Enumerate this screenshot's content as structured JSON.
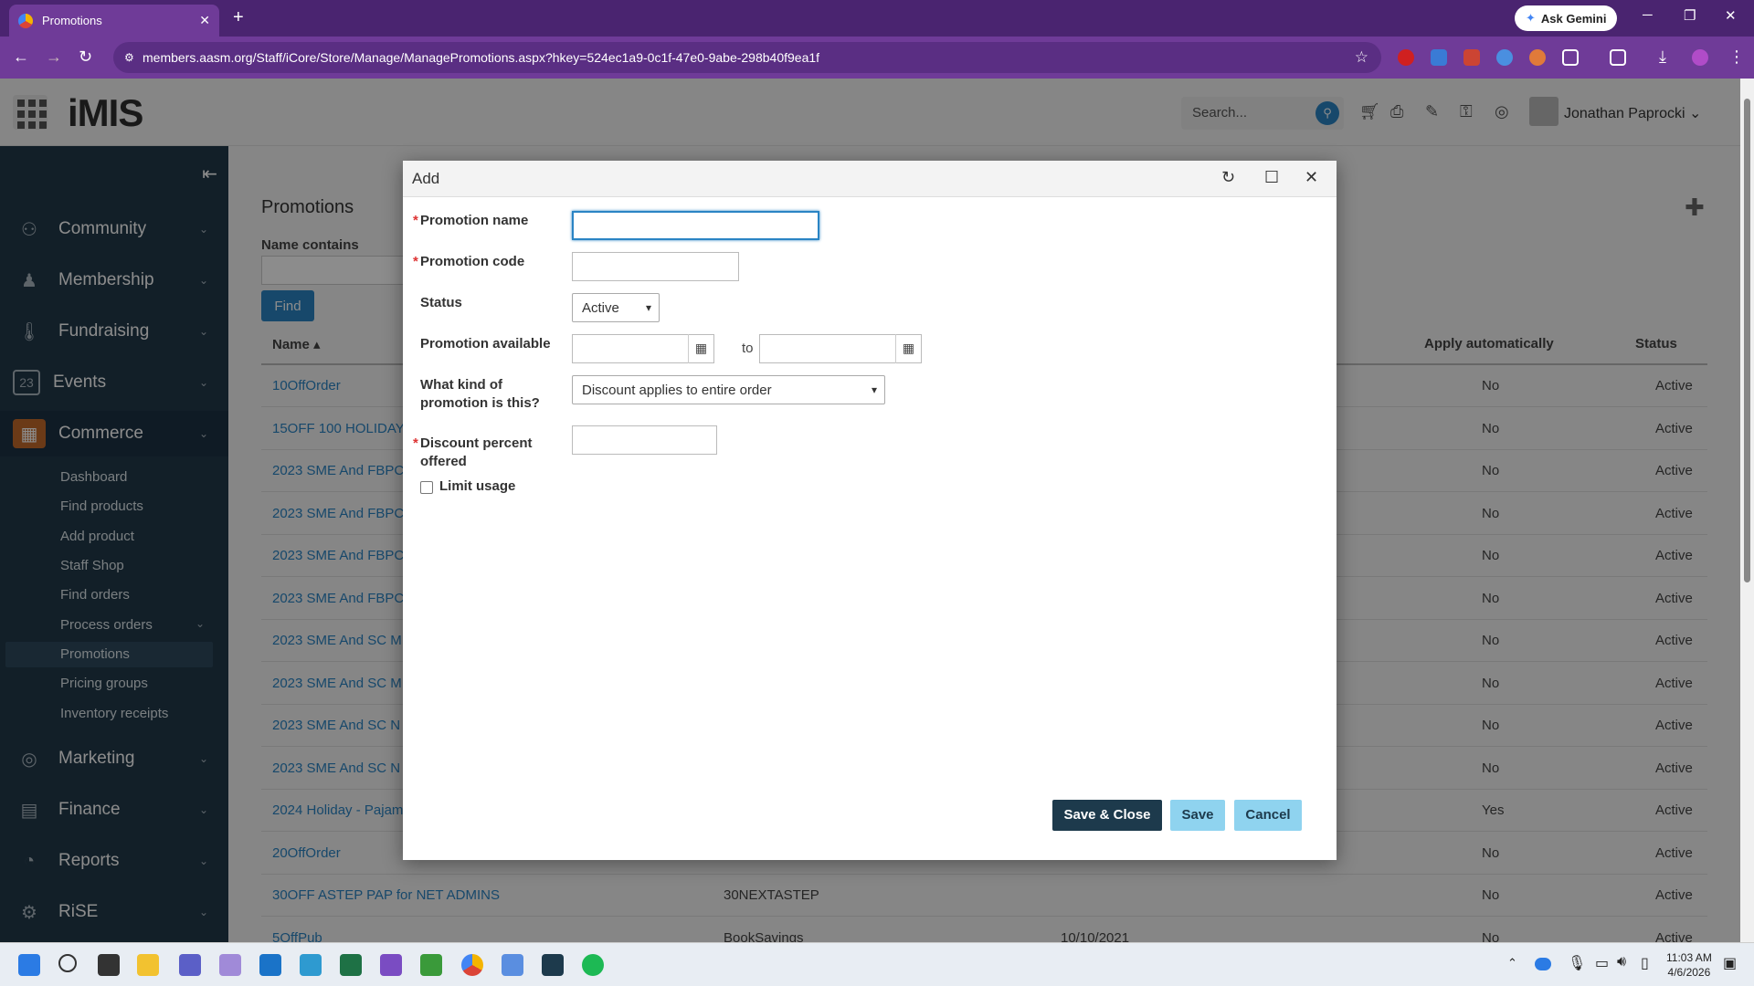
{
  "browser": {
    "tab_title": "Promotions",
    "url": "members.aasm.org/Staff/iCore/Store/Manage/ManagePromotions.aspx?hkey=524ec1a9-0c1f-47e0-9abe-298b40f9ea1f",
    "gemini_label": "Ask Gemini"
  },
  "header": {
    "logo": "iMIS",
    "search_placeholder": "Search...",
    "user_name": "Jonathan Paprocki"
  },
  "sidebar": {
    "items": [
      {
        "label": "Community"
      },
      {
        "label": "Membership"
      },
      {
        "label": "Fundraising"
      },
      {
        "label": "Events"
      },
      {
        "label": "Commerce"
      },
      {
        "label": "Marketing"
      },
      {
        "label": "Finance"
      },
      {
        "label": "Reports"
      },
      {
        "label": "RiSE"
      }
    ],
    "commerce_sub": [
      "Dashboard",
      "Find products",
      "Add product",
      "Staff Shop",
      "Find orders",
      "Process orders",
      "Promotions",
      "Pricing groups",
      "Inventory receipts"
    ]
  },
  "page": {
    "title": "Promotions",
    "name_contains_label": "Name contains",
    "find_label": "Find",
    "columns": {
      "name": "Name ▴",
      "apply": "Apply automatically",
      "status": "Status"
    },
    "rows": [
      {
        "name": "10OffOrder",
        "code": "",
        "date": "",
        "apply": "No",
        "status": "Active"
      },
      {
        "name": "15OFF 100 HOLIDAY",
        "code": "",
        "date": "",
        "apply": "No",
        "status": "Active"
      },
      {
        "name": "2023 SME And FBPC",
        "code": "",
        "date": "",
        "apply": "No",
        "status": "Active"
      },
      {
        "name": "2023 SME And FBPC",
        "code": "",
        "date": "",
        "apply": "No",
        "status": "Active"
      },
      {
        "name": "2023 SME And FBPC",
        "code": "",
        "date": "",
        "apply": "No",
        "status": "Active"
      },
      {
        "name": "2023 SME And FBPC",
        "code": "",
        "date": "",
        "apply": "No",
        "status": "Active"
      },
      {
        "name": "2023 SME And SC M",
        "code": "",
        "date": "",
        "apply": "No",
        "status": "Active"
      },
      {
        "name": "2023 SME And SC M",
        "code": "",
        "date": "",
        "apply": "No",
        "status": "Active"
      },
      {
        "name": "2023 SME And SC N",
        "code": "",
        "date": "",
        "apply": "No",
        "status": "Active"
      },
      {
        "name": "2023 SME And SC N",
        "code": "",
        "date": "",
        "apply": "No",
        "status": "Active"
      },
      {
        "name": "2024 Holiday - Pajam",
        "code": "",
        "date": "",
        "apply": "Yes",
        "status": "Active"
      },
      {
        "name": "20OffOrder",
        "code": "",
        "date": "",
        "apply": "No",
        "status": "Active"
      },
      {
        "name": "30OFF ASTEP PAP for NET ADMINS",
        "code": "30NEXTASTEP",
        "date": "",
        "apply": "No",
        "status": "Active"
      },
      {
        "name": "5OffPub",
        "code": "BookSavings",
        "date": "10/10/2021",
        "apply": "No",
        "status": "Active"
      }
    ]
  },
  "dialog": {
    "title": "Add",
    "promotion_name_label": "Promotion name",
    "promotion_code_label": "Promotion code",
    "status_label": "Status",
    "status_value": "Active",
    "available_label": "Promotion available",
    "to_label": "to",
    "kind_label_1": "What kind of",
    "kind_label_2": "promotion is this?",
    "kind_value": "Discount applies to entire order",
    "discount_label_1": "Discount percent",
    "discount_label_2": "offered",
    "limit_label": "Limit usage",
    "save_close": "Save & Close",
    "save": "Save",
    "cancel": "Cancel"
  },
  "taskbar": {
    "time": "11:03 AM",
    "date": "4/6/2026"
  }
}
